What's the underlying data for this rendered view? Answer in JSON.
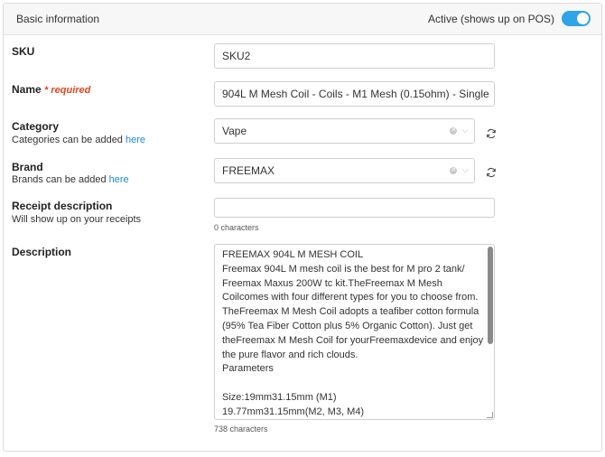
{
  "header": {
    "title": "Basic information",
    "active_label": "Active (shows up on POS)",
    "active_on": true,
    "accent_color": "#2fa4e7"
  },
  "sku": {
    "label": "SKU",
    "value": "SKU2"
  },
  "name": {
    "label": "Name",
    "required": "* required",
    "value": "904L M Mesh Coil - Coils - M1 Mesh (0.15ohm) - Single"
  },
  "category": {
    "label": "Category",
    "hint": "Categories can be added",
    "link": "here",
    "value": "Vape"
  },
  "brand": {
    "label": "Brand",
    "hint": "Brands can be added",
    "link": "here",
    "value": "FREEMAX"
  },
  "receipt": {
    "label": "Receipt description",
    "hint": "Will show up on your receipts",
    "value": "",
    "count": "0 characters"
  },
  "description": {
    "label": "Description",
    "value": "FREEMAX 904L M MESH COIL\nFreemax 904L M mesh coil is the best for M pro 2 tank/ Freemax Maxus 200W tc kit.TheFreemax M Mesh Coilcomes with four different types for you to choose from. TheFreemax M Mesh Coil adopts a teafiber cotton formula (95% Tea Fiber Cotton plus 5% Organic Cotton). Just get theFreemax M Mesh Coil for yourFreemaxdevice and enjoy the pure flavor and rich clouds.\nParameters\n\nSize:19mm31.15mm (M1)\n19.77mm31.15mm(M2, M3, M4)",
    "count": "738 characters"
  },
  "icons": {
    "clear": "clear-icon",
    "chevron": "chevron-down-icon",
    "refresh": "refresh-icon"
  }
}
